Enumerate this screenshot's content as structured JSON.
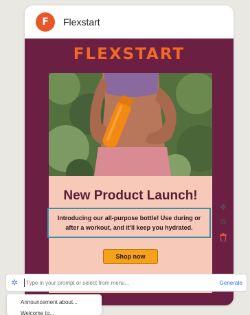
{
  "sender": {
    "avatar_letter": "F",
    "name": "Flexstart"
  },
  "email": {
    "brand_logo": "FLEXSTART",
    "hero_image": "woman holding orange water bottle",
    "headline": "New Product Launch!",
    "body_text": "Introducing our all-purpose bottle! Use during or after a workout, and it'll keep you hydrated.",
    "cta_label": "Shop now"
  },
  "toolbar": {
    "move_icon": "move-icon",
    "duplicate_icon": "duplicate-icon",
    "delete_icon": "trash-icon"
  },
  "prompt": {
    "placeholder": "Type in your prompt or select from menu...",
    "value": "",
    "generate_label": "Generate"
  },
  "menu": {
    "items": [
      "Announcement about...",
      "Welcome to..."
    ]
  },
  "colors": {
    "brand_orange": "#f06a24",
    "email_background": "#6b1f42",
    "panel_background": "#f6c9b9",
    "button": "#f4a21c",
    "selection_outline": "#3a8fa3",
    "link_blue": "#2f6fdb"
  }
}
